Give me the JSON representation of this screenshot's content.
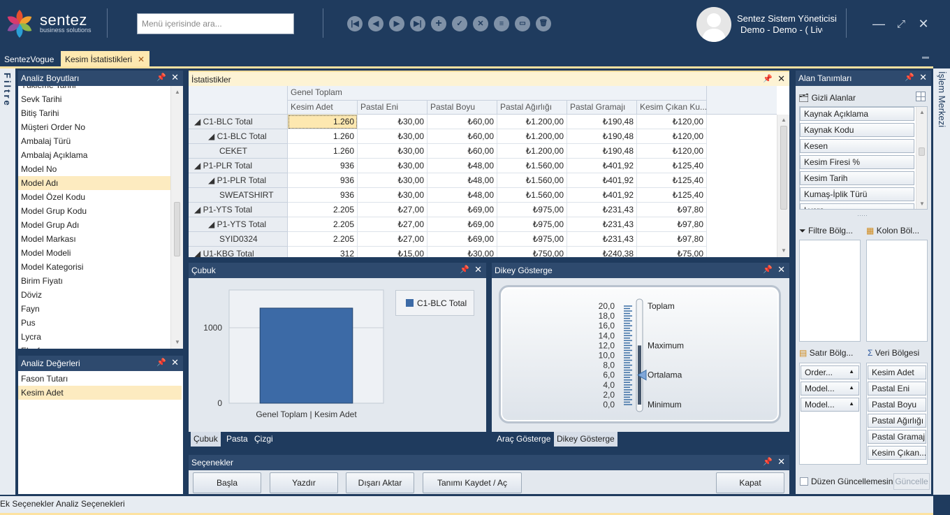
{
  "app": {
    "logo_name": "sentez",
    "logo_sub": "business solutions",
    "search_placeholder": "Menü içerisinde ara...",
    "user_name": "Sentez Sistem Yöneticisi",
    "user_sub": "Demo - Demo - ( Live)",
    "toolbar_icons": [
      "first-icon",
      "prev-icon",
      "next-icon",
      "last-icon",
      "add-icon",
      "approve-icon",
      "cancel-icon",
      "list-icon",
      "card-icon",
      "delete-icon"
    ]
  },
  "tabs": [
    {
      "label": "SentezVogue"
    },
    {
      "label": "Kesim İstatistikleri"
    }
  ],
  "side": {
    "left_label": "Filtre",
    "right_label": "İşlem Merkezi"
  },
  "analiz_boyutlari": {
    "title": "Analiz Boyutları",
    "items": [
      "Yükleme Tarihi",
      "Sevk Tarihi",
      "Bitiş Tarihi",
      "Müşteri Order No",
      "Ambalaj Türü",
      "Ambalaj Açıklama",
      "Model No",
      "Model Adı",
      "Model Özel Kodu",
      "Model Grup Kodu",
      "Model Grup Adı",
      "Model Markası",
      "Model Modeli",
      "Model Kategorisi",
      "Birim Fiyatı",
      "Döviz",
      "Fayn",
      "Pus",
      "Lycra",
      "Elyaf"
    ],
    "selected": "Model Adı"
  },
  "analiz_degerleri": {
    "title": "Analiz Değerleri",
    "items": [
      "Fason Tutarı",
      "Kesim Adet"
    ],
    "selected": "Kesim Adet"
  },
  "istatistikler": {
    "title": "İstatistikler",
    "group_header": "Genel Toplam",
    "columns": [
      "Kesim Adet",
      "Pastal Eni",
      "Pastal Boyu",
      "Pastal Ağırlığı",
      "Pastal Gramajı",
      "Kesim Çıkan Ku..."
    ],
    "rows": [
      {
        "label": "◢ C1-BLC Total",
        "level": 0,
        "values": [
          "1.260",
          "₺30,00",
          "₺60,00",
          "₺1.200,00",
          "₺190,48",
          "₺120,00"
        ]
      },
      {
        "label": "◢ C1-BLC Total",
        "level": 1,
        "values": [
          "1.260",
          "₺30,00",
          "₺60,00",
          "₺1.200,00",
          "₺190,48",
          "₺120,00"
        ]
      },
      {
        "label": "CEKET",
        "level": 2,
        "values": [
          "1.260",
          "₺30,00",
          "₺60,00",
          "₺1.200,00",
          "₺190,48",
          "₺120,00"
        ]
      },
      {
        "label": "◢ P1-PLR Total",
        "level": 0,
        "values": [
          "936",
          "₺30,00",
          "₺48,00",
          "₺1.560,00",
          "₺401,92",
          "₺125,40"
        ]
      },
      {
        "label": "◢ P1-PLR Total",
        "level": 1,
        "values": [
          "936",
          "₺30,00",
          "₺48,00",
          "₺1.560,00",
          "₺401,92",
          "₺125,40"
        ]
      },
      {
        "label": "SWEATSHIRT",
        "level": 2,
        "values": [
          "936",
          "₺30,00",
          "₺48,00",
          "₺1.560,00",
          "₺401,92",
          "₺125,40"
        ]
      },
      {
        "label": "◢ P1-YTS Total",
        "level": 0,
        "values": [
          "2.205",
          "₺27,00",
          "₺69,00",
          "₺975,00",
          "₺231,43",
          "₺97,80"
        ]
      },
      {
        "label": "◢ P1-YTS Total",
        "level": 1,
        "values": [
          "2.205",
          "₺27,00",
          "₺69,00",
          "₺975,00",
          "₺231,43",
          "₺97,80"
        ]
      },
      {
        "label": "SYID0324",
        "level": 2,
        "values": [
          "2.205",
          "₺27,00",
          "₺69,00",
          "₺975,00",
          "₺231,43",
          "₺97,80"
        ]
      },
      {
        "label": "◢ U1-KBG Total",
        "level": 0,
        "values": [
          "312",
          "₺15,00",
          "₺30,00",
          "₺750,00",
          "₺240,38",
          "₺75,00"
        ]
      }
    ]
  },
  "cubuk": {
    "title": "Çubuk",
    "tabs": [
      "Çubuk",
      "Pasta",
      "Çizgi"
    ],
    "active_tab": "Çubuk"
  },
  "chart_data": {
    "type": "bar",
    "categories": [
      "Genel Toplam | Kesim Adet"
    ],
    "series": [
      {
        "name": "C1-BLC Total",
        "values": [
          1260
        ]
      }
    ],
    "xlabel": "Genel Toplam | Kesim Adet",
    "yticks": [
      "0",
      "1000"
    ],
    "ylim": [
      0,
      1500
    ],
    "legend": "right",
    "grid": true
  },
  "gosterge": {
    "title": "Dikey Gösterge",
    "tabs": [
      "Araç Gösterge",
      "Dikey Gösterge"
    ],
    "active_tab": "Dikey Gösterge",
    "scale": [
      "20,0",
      "18,0",
      "16,0",
      "14,0",
      "12,0",
      "10,0",
      "8,0",
      "6,0",
      "4,0",
      "2,0",
      "0,0"
    ],
    "labels": {
      "toplam": "Toplam",
      "maximum": "Maximum",
      "ortalama": "Ortalama",
      "minimum": "Minimum"
    },
    "max_value": 12,
    "avg_value": 6,
    "scale_max": 20
  },
  "secenekler": {
    "title": "Seçenekler",
    "buttons": [
      "Başla",
      "Yazdır",
      "Dışarı Aktar",
      "Tanımı Kaydet / Aç",
      "Kapat"
    ]
  },
  "alan": {
    "title": "Alan Tanımları",
    "hidden_label": "Gizli Alanlar",
    "hidden_fields": [
      "Kaynak Açıklama",
      "Kaynak Kodu",
      "Kesen",
      "Kesim Firesi %",
      "Kesim Tarih",
      "Kumaş-İplik Türü",
      "Lycra"
    ],
    "filter_zone": "Filtre Bölg...",
    "column_zone": "Kolon Böl...",
    "row_zone": "Satır Bölg...",
    "data_zone": "Veri Bölgesi",
    "row_fields": [
      "Order...",
      "Model...",
      "Model..."
    ],
    "data_fields": [
      "Kesim Adet",
      "Pastal Eni",
      "Pastal Boyu",
      "Pastal Ağırlığı",
      "Pastal Gramajı",
      "Kesim Çıkan..."
    ],
    "defer_label": "Düzen Güncellemesini Ertele",
    "update_label": "Güncelle"
  },
  "bottom": {
    "ek": "Ek Seçenekler",
    "analiz": "Analiz Seçenekleri"
  },
  "colors": {
    "header": "#1f3b5e",
    "panel_header": "#2e4a6e",
    "selected": "#fdebc0",
    "bar": "#3c6aa6"
  }
}
